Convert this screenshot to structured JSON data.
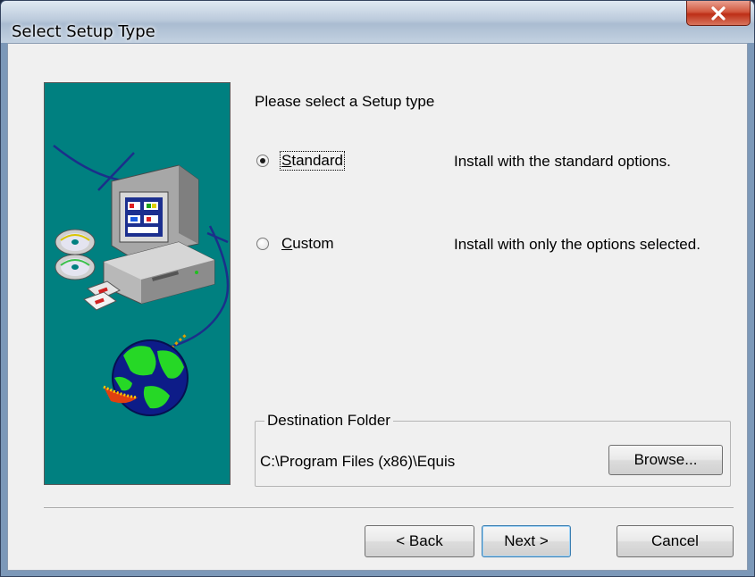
{
  "window": {
    "title": "Select Setup Type",
    "close_glyph": "X"
  },
  "main": {
    "prompt": "Please select a Setup type",
    "options": [
      {
        "label": "Standard",
        "mnemonic": "S",
        "description": "Install with the standard options.",
        "selected": true
      },
      {
        "label": "Custom",
        "mnemonic": "C",
        "description": "Install with only the options selected.",
        "selected": false
      }
    ],
    "destination": {
      "legend": "Destination Folder",
      "path": "C:\\Program Files (x86)\\Equis",
      "browse_label": "Browse..."
    }
  },
  "buttons": {
    "back_label": "< Back",
    "next_label": "Next >",
    "cancel_label": "Cancel"
  },
  "colors": {
    "art_background": "#008080",
    "close_button": "#c7412a",
    "dialog_background": "#f0f0f0"
  },
  "icons": [
    "close-icon",
    "computer-illustration",
    "cd-disc-icon",
    "floppy-disk-icon",
    "globe-icon"
  ]
}
